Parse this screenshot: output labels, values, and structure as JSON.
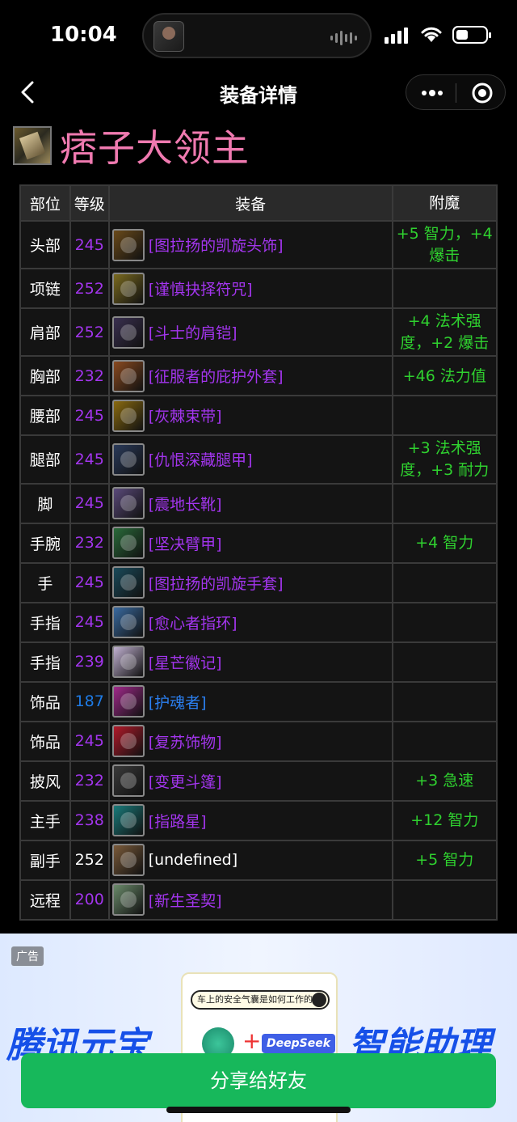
{
  "status_bar": {
    "time": "10:04"
  },
  "nav": {
    "title": "装备详情"
  },
  "character": {
    "name": "痞子大领主",
    "name_color": "#f07ab0"
  },
  "table": {
    "headers": {
      "slot": "部位",
      "level": "等级",
      "item": "装备",
      "enchant": "附魔"
    },
    "rows": [
      {
        "slot": "头部",
        "level": "245",
        "quality": "epic",
        "item": "[图拉扬的凯旋头饰]",
        "enchant": "+5 智力，+4 爆击",
        "icon_color": "#6a4a1a"
      },
      {
        "slot": "项链",
        "level": "252",
        "quality": "epic",
        "item": "[谨慎抉择符咒]",
        "enchant": "",
        "icon_color": "#7a6a20"
      },
      {
        "slot": "肩部",
        "level": "252",
        "quality": "epic",
        "item": "[斗士的肩铠]",
        "enchant": "+4 法术强度，+2 爆击",
        "icon_color": "#3a3050"
      },
      {
        "slot": "胸部",
        "level": "232",
        "quality": "epic",
        "item": "[征服者的庇护外套]",
        "enchant": "+46 法力值",
        "icon_color": "#8a4a20"
      },
      {
        "slot": "腰部",
        "level": "245",
        "quality": "epic",
        "item": "[灰棘束带]",
        "enchant": "",
        "icon_color": "#8a6a10"
      },
      {
        "slot": "腿部",
        "level": "245",
        "quality": "epic",
        "item": "[仇恨深藏腿甲]",
        "enchant": "+3 法术强度，+3 耐力",
        "icon_color": "#2a3a5a"
      },
      {
        "slot": "脚",
        "level": "245",
        "quality": "epic",
        "item": "[震地长靴]",
        "enchant": "",
        "icon_color": "#5a4a7a"
      },
      {
        "slot": "手腕",
        "level": "232",
        "quality": "epic",
        "item": "[坚决臂甲]",
        "enchant": "+4 智力",
        "icon_color": "#2a6a3a"
      },
      {
        "slot": "手",
        "level": "245",
        "quality": "epic",
        "item": "[图拉扬的凯旋手套]",
        "enchant": "",
        "icon_color": "#1a4a5a"
      },
      {
        "slot": "手指",
        "level": "245",
        "quality": "epic",
        "item": "[愈心者指环]",
        "enchant": "",
        "icon_color": "#3a6aa0"
      },
      {
        "slot": "手指",
        "level": "239",
        "quality": "epic",
        "item": "[星芒徽记]",
        "enchant": "",
        "icon_color": "#c0b0d0"
      },
      {
        "slot": "饰品",
        "level": "187",
        "quality": "rare",
        "item": "[护魂者]",
        "enchant": "",
        "icon_color": "#a02a8a"
      },
      {
        "slot": "饰品",
        "level": "245",
        "quality": "epic",
        "item": "[复苏饰物]",
        "enchant": "",
        "icon_color": "#b01a2a"
      },
      {
        "slot": "披风",
        "level": "232",
        "quality": "epic",
        "item": "[变更斗篷]",
        "enchant": "+3 急速",
        "icon_color": "#3a3a3a"
      },
      {
        "slot": "主手",
        "level": "238",
        "quality": "epic",
        "item": "[指路星]",
        "enchant": "+12 智力",
        "icon_color": "#1a7a7a"
      },
      {
        "slot": "副手",
        "level": "252",
        "quality": "common",
        "item": "[undefined]",
        "enchant": "+5 智力",
        "icon_color": "#7a5a3a"
      },
      {
        "slot": "远程",
        "level": "200",
        "quality": "epic",
        "item": "[新生圣契]",
        "enchant": "",
        "icon_color": "#6a8a6a"
      }
    ]
  },
  "ad": {
    "label": "广告",
    "left_text": "腾讯元宝",
    "right_text": "智能助理",
    "search_text": "车上的安全气囊是如何工作的",
    "brand_text": "DeepSeek"
  },
  "share_button": {
    "label": "分享给好友"
  },
  "colors": {
    "epic": "#a335ee",
    "rare": "#2b7ff0",
    "enchant": "#2fd12f",
    "share": "#17b85b"
  }
}
